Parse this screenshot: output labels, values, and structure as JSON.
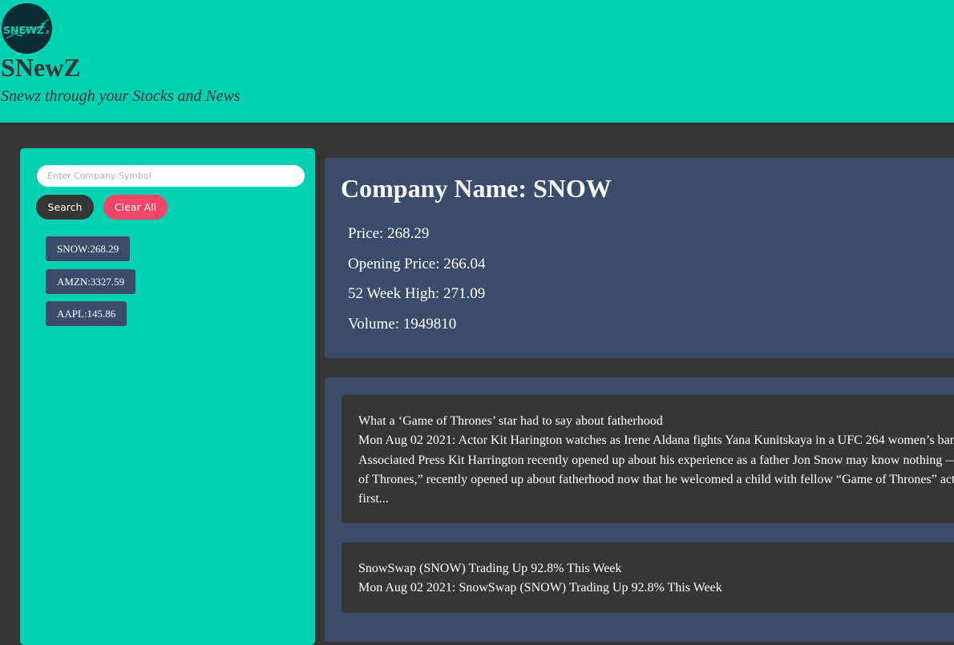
{
  "header": {
    "logo_text": "SNEWZz",
    "title": "SNewZ",
    "subtitle": "Snewz through your Stocks and News"
  },
  "sidebar": {
    "search_placeholder": "Enter Company Symbol",
    "search_button": "Search",
    "clear_button": "Clear All",
    "history": [
      {
        "label": "SNOW:268.29"
      },
      {
        "label": "AMZN:3327.59"
      },
      {
        "label": "AAPL:145.86"
      }
    ]
  },
  "stock": {
    "title": "Company Name: SNOW",
    "price": "Price: 268.29",
    "opening_price": "Opening Price: 266.04",
    "week52_high": "52 Week High: 271.09",
    "volume": "Volume: 1949810"
  },
  "news": [
    {
      "lines": [
        "What a ‘Game of Thrones’ star had to say about fatherhood",
        "Mon Aug 02 2021: Actor Kit Harington watches as Irene Aldana fights Yana Kunitskaya in a UFC 264 women’s ban",
        "Associated Press Kit Harrington recently opened up about his experience as a father Jon Snow may know nothing —",
        "of Thrones,” recently opened up about fatherhood now that he welcomed a child with fellow “Game of Thrones” act",
        "first..."
      ]
    },
    {
      "lines": [
        "SnowSwap (SNOW) Trading Up 92.8% This Week",
        "Mon Aug 02 2021: SnowSwap (SNOW) Trading Up 92.8% This Week"
      ]
    }
  ],
  "colors": {
    "primary": "#00d1b2",
    "dark": "#363636",
    "card": "#3b4c6b",
    "danger": "#f14668"
  }
}
